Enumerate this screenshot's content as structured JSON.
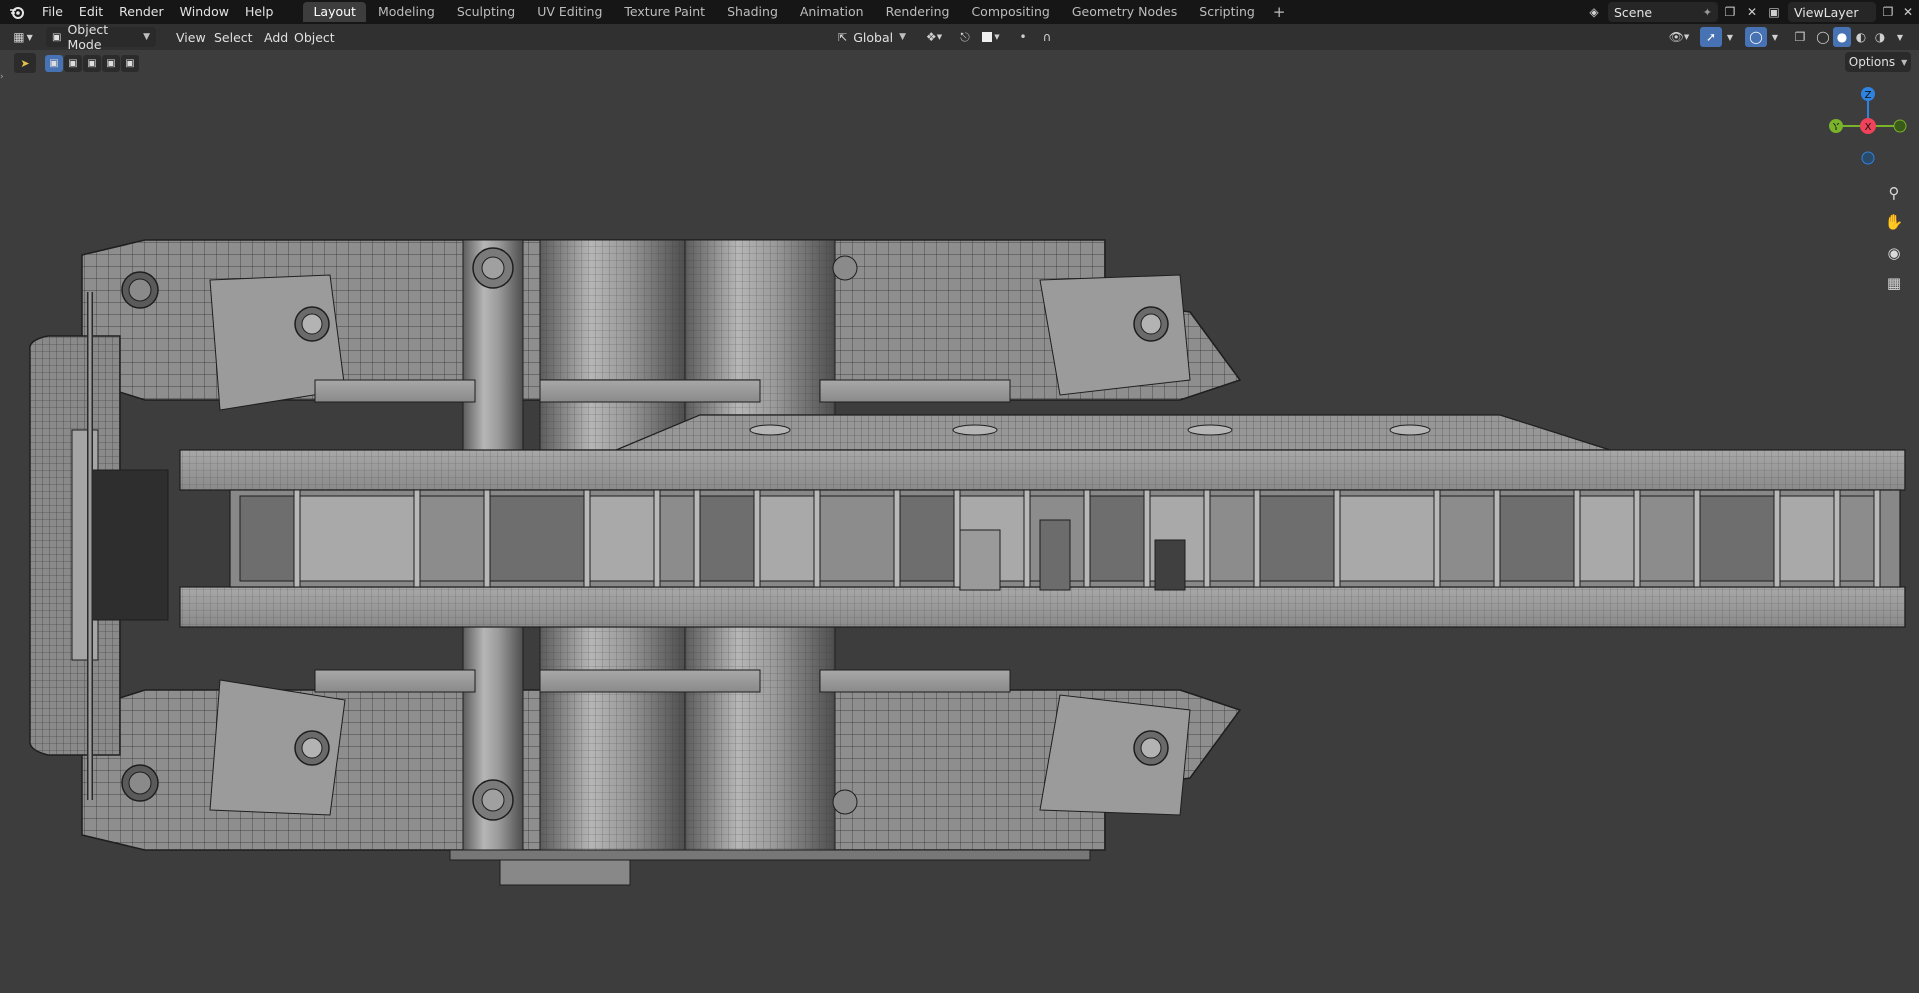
{
  "menubar": {
    "app_icon": "blender-logo-icon",
    "items": [
      "File",
      "Edit",
      "Render",
      "Window",
      "Help"
    ]
  },
  "workspace_tabs": {
    "items": [
      "Layout",
      "Modeling",
      "Sculpting",
      "UV Editing",
      "Texture Paint",
      "Shading",
      "Animation",
      "Rendering",
      "Compositing",
      "Geometry Nodes",
      "Scripting"
    ],
    "active": "Layout",
    "add_symbol": "+"
  },
  "scene": {
    "label": "Scene",
    "icon": "scene-icon"
  },
  "view_layer": {
    "label": "ViewLayer",
    "icon": "view-layer-icon"
  },
  "header": {
    "editor_icon": "editor-type-icon",
    "mode": "Object Mode",
    "menus": [
      "View",
      "Select",
      "Add",
      "Object"
    ],
    "transform_orientation": "Global",
    "pivot_icon": "pivot-point-icon",
    "snap_icon": "snap-icon",
    "proportional_icon": "proportional-edit-icon"
  },
  "viewport_header_right": {
    "options_label": "Options",
    "shading_modes": [
      "wireframe",
      "solid",
      "material",
      "rendered"
    ],
    "active_shading": "solid"
  },
  "navigation_gizmo": {
    "axes": [
      {
        "label": "Z",
        "color": "#2f83e0"
      },
      {
        "label": "X",
        "color": "#f0435a"
      },
      {
        "label": "Y",
        "color": "#7ab22a"
      }
    ],
    "tools": [
      "zoom-icon",
      "pan-hand-icon",
      "camera-view-icon",
      "perspective-grid-icon"
    ]
  },
  "colors": {
    "accent": "#4772b3",
    "viewport_bg": "#3d3d3d",
    "topbar_bg": "#161616",
    "header_bg": "#303030"
  }
}
